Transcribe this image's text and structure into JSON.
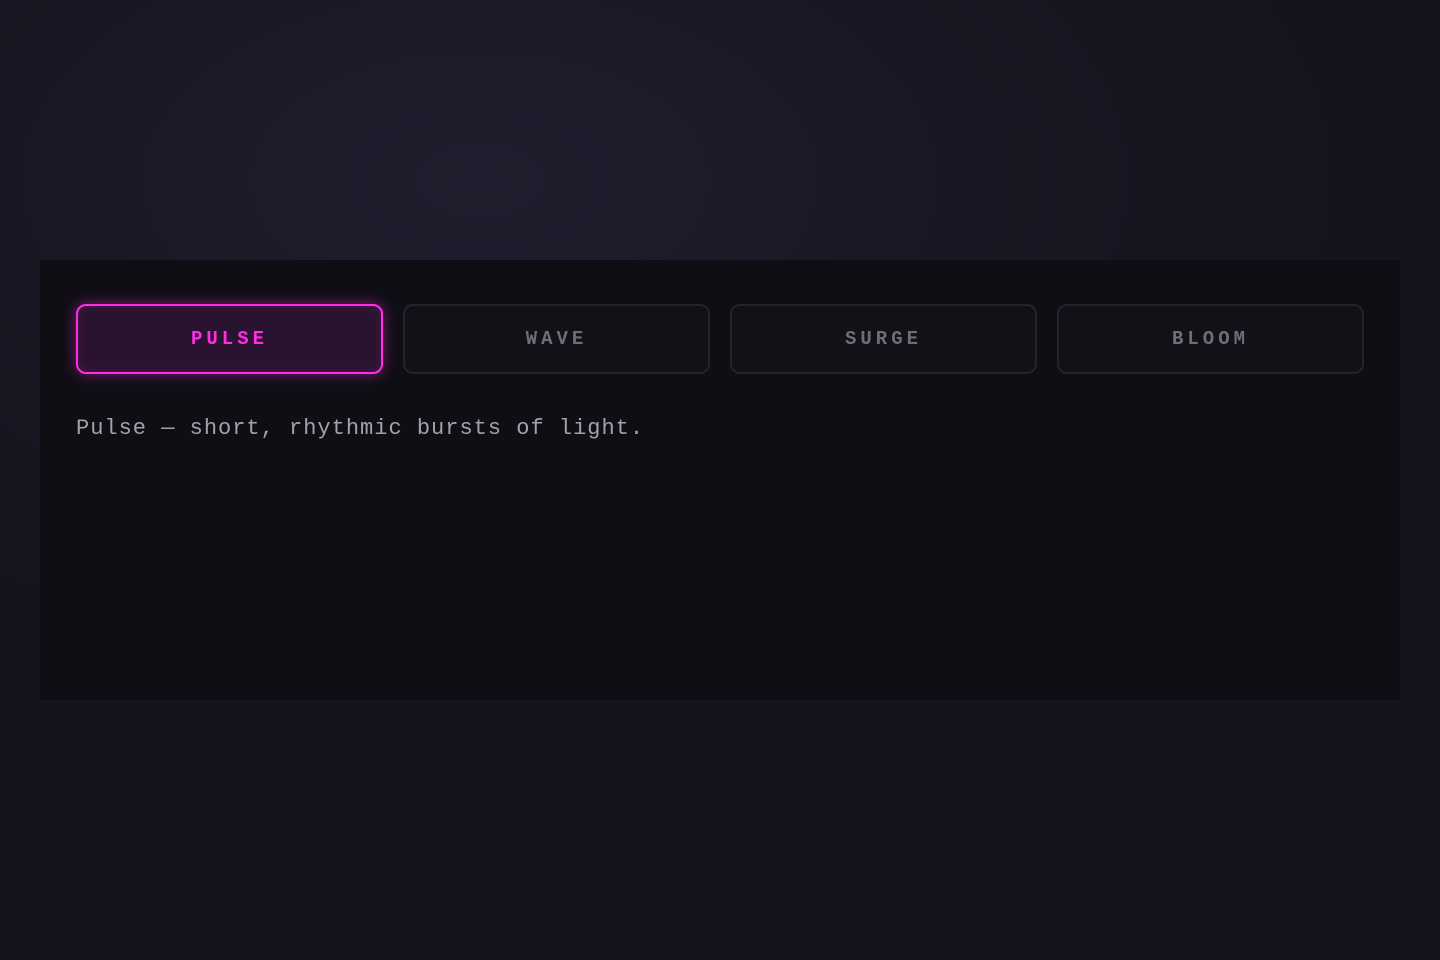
{
  "tabs": [
    {
      "label": "PULSE",
      "active": true
    },
    {
      "label": "WAVE",
      "active": false
    },
    {
      "label": "SURGE",
      "active": false
    },
    {
      "label": "BLOOM",
      "active": false
    }
  ],
  "description": "Pulse — short, rhythmic bursts of light.",
  "colors": {
    "accent": "#ff2ee6",
    "panel_background": "#0f0e14",
    "inactive_text": "#6f6d76",
    "description_text": "#a3a1aa"
  }
}
